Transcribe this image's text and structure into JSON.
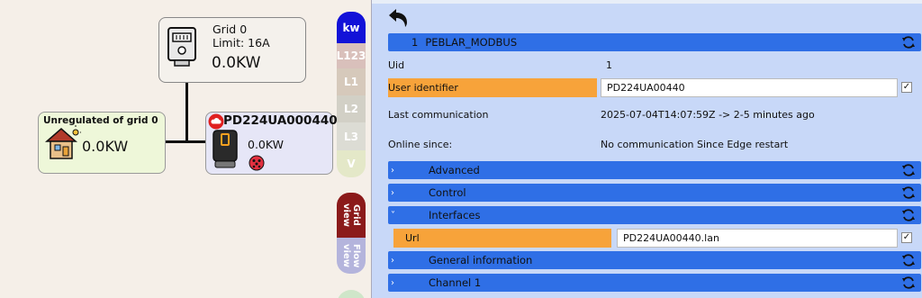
{
  "diagram": {
    "grid_node": {
      "title": "Grid 0",
      "limit": "Limit: 16A",
      "power": "0.0KW"
    },
    "unreg_node": {
      "title": "Unregulated of grid 0",
      "power": "0.0KW"
    },
    "ev_node": {
      "title": "PD224UA000440",
      "power": "0.0KW"
    }
  },
  "vertical_tabs": {
    "kw": "kw",
    "l123": "L123",
    "l1": "L1",
    "l2": "L2",
    "l3": "L3",
    "v": "V",
    "grid_view": "Grid view",
    "flow_view": "Flow view"
  },
  "panel": {
    "header": {
      "number": "1",
      "title": "PEBLAR_MODBUS"
    },
    "uid": {
      "label": "Uid",
      "value": "1"
    },
    "user_identifier": {
      "label": "User identifier",
      "value": "PD224UA00440"
    },
    "last_communication": {
      "label": "Last communication",
      "value": "2025-07-04T14:07:59Z  -> 2-5 minutes ago"
    },
    "online_since": {
      "label": "Online since:",
      "value": "No communication Since Edge restart"
    },
    "sections": {
      "advanced": "Advanced",
      "control": "Control",
      "interfaces": "Interfaces",
      "general_information": "General information",
      "channel_1": "Channel 1"
    },
    "url": {
      "label": "Url",
      "value": "PD224UA00440.lan"
    }
  },
  "colors": {
    "bar_blue": "#2f6fe6",
    "panel_bg": "#c8d8f8",
    "orange_field": "#f7a33a",
    "kw_tab": "#1212d8",
    "grid_view_tab": "#8b1a1a"
  }
}
